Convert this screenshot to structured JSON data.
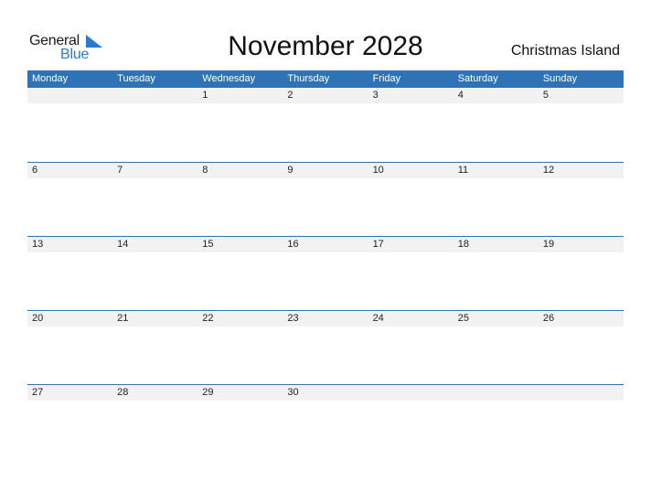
{
  "logo": {
    "general": "General",
    "blue": "Blue",
    "icon": "blue-triangle-logo-icon"
  },
  "title": "November 2028",
  "region": "Christmas Island",
  "calendar": {
    "weekdays": [
      "Monday",
      "Tuesday",
      "Wednesday",
      "Thursday",
      "Friday",
      "Saturday",
      "Sunday"
    ],
    "weeks": [
      [
        "",
        "",
        "1",
        "2",
        "3",
        "4",
        "5"
      ],
      [
        "6",
        "7",
        "8",
        "9",
        "10",
        "11",
        "12"
      ],
      [
        "13",
        "14",
        "15",
        "16",
        "17",
        "18",
        "19"
      ],
      [
        "20",
        "21",
        "22",
        "23",
        "24",
        "25",
        "26"
      ],
      [
        "27",
        "28",
        "29",
        "30",
        "",
        "",
        ""
      ]
    ]
  },
  "colors": {
    "accent": "#2e73b6",
    "logo_blue": "#2a7bd0",
    "row_bg": "#f2f2f2"
  }
}
